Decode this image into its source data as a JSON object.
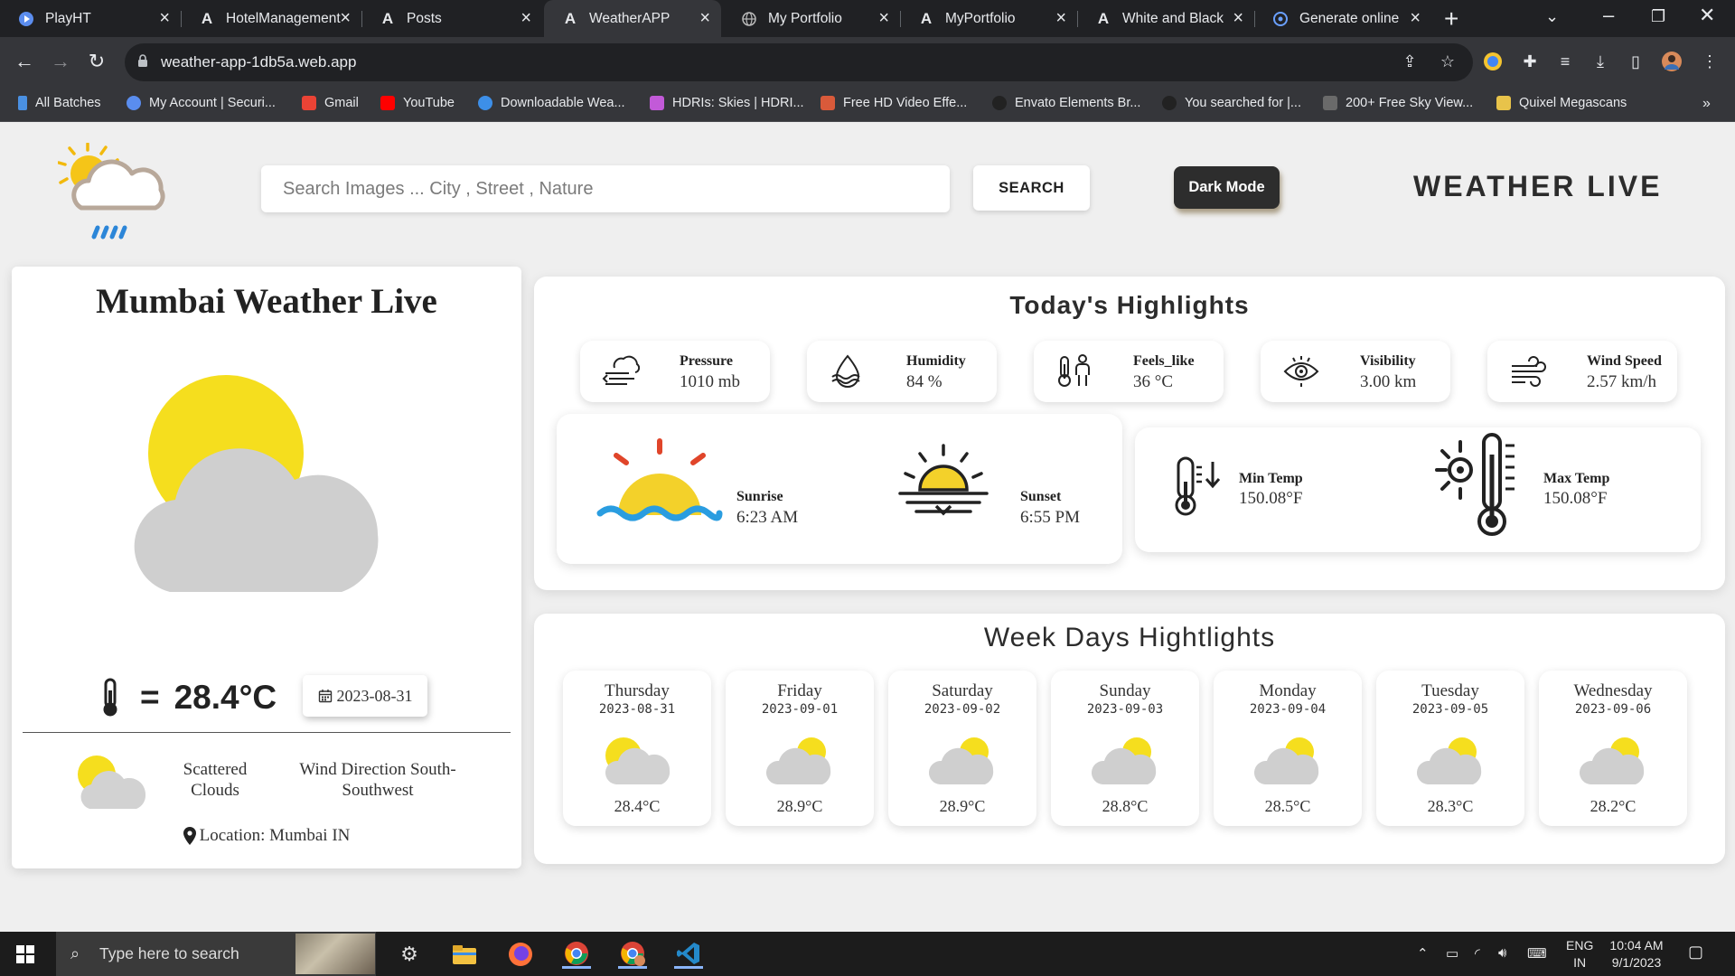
{
  "browser": {
    "tabs": [
      {
        "title": "PlayHT",
        "icon": "playht-icon"
      },
      {
        "title": "HotelManagement",
        "icon": "vercel-icon"
      },
      {
        "title": "Posts",
        "icon": "vercel-icon"
      },
      {
        "title": "WeatherAPP",
        "icon": "vercel-icon",
        "active": true
      },
      {
        "title": "My Portfolio",
        "icon": "globe-icon"
      },
      {
        "title": "MyPortfolio",
        "icon": "vercel-icon"
      },
      {
        "title": "White and Black",
        "icon": "vercel-icon"
      },
      {
        "title": "Generate online",
        "icon": "generator-icon"
      }
    ],
    "url": "weather-app-1db5a.web.app",
    "bookmarks": [
      {
        "label": "All Batches",
        "color": "#4a90e2"
      },
      {
        "label": "My Account | Securi...",
        "color": "#5a8dee"
      },
      {
        "label": "Gmail",
        "color": "#ea4335"
      },
      {
        "label": "YouTube",
        "color": "#ff0000"
      },
      {
        "label": "Downloadable Wea...",
        "color": "#3d8fe8"
      },
      {
        "label": "HDRIs: Skies | HDRI...",
        "color": "#c25ad8"
      },
      {
        "label": "Free HD Video Effe...",
        "color": "#d95a3a"
      },
      {
        "label": "Envato Elements Br...",
        "color": "#333333"
      },
      {
        "label": "You searched for |...",
        "color": "#333333"
      },
      {
        "label": "200+ Free Sky View...",
        "color": "#6a6a6a"
      },
      {
        "label": "Quixel Megascans",
        "color": "#e8c34a"
      }
    ]
  },
  "header": {
    "search_placeholder": "Search Images ... City , Street , Nature",
    "search_label": "SEARCH",
    "dark_mode_label": "Dark Mode",
    "app_title": "WEATHER LIVE"
  },
  "current": {
    "city_title": "Mumbai Weather Live",
    "temp_prefix": "=",
    "temp": "28.4°C",
    "date": "2023-08-31",
    "condition": "Scattered Clouds",
    "wind_direction": "Wind Direction South-Southwest",
    "location": "Location: Mumbai IN"
  },
  "highlights": {
    "title": "Today's Highlights",
    "stats": [
      {
        "label": "Pressure",
        "value": "1010 mb",
        "icon": "pressure-icon"
      },
      {
        "label": "Humidity",
        "value": "84 %",
        "icon": "humidity-icon"
      },
      {
        "label": "Feels_like",
        "value": "36 °C",
        "icon": "feels-like-icon"
      },
      {
        "label": "Visibility",
        "value": "3.00 km",
        "icon": "visibility-icon"
      },
      {
        "label": "Wind Speed",
        "value": "2.57 km/h",
        "icon": "wind-icon"
      }
    ],
    "sunrise_label": "Sunrise",
    "sunrise_value": "6:23 AM",
    "sunset_label": "Sunset",
    "sunset_value": "6:55 PM",
    "min_label": "Min Temp",
    "min_value": "150.08°F",
    "max_label": "Max Temp",
    "max_value": "150.08°F"
  },
  "week": {
    "title": "Week Days Hightlights",
    "days": [
      {
        "day": "Thursday",
        "date": "2023-08-31",
        "temp": "28.4°C"
      },
      {
        "day": "Friday",
        "date": "2023-09-01",
        "temp": "28.9°C"
      },
      {
        "day": "Saturday",
        "date": "2023-09-02",
        "temp": "28.9°C"
      },
      {
        "day": "Sunday",
        "date": "2023-09-03",
        "temp": "28.8°C"
      },
      {
        "day": "Monday",
        "date": "2023-09-04",
        "temp": "28.5°C"
      },
      {
        "day": "Tuesday",
        "date": "2023-09-05",
        "temp": "28.3°C"
      },
      {
        "day": "Wednesday",
        "date": "2023-09-06",
        "temp": "28.2°C"
      }
    ]
  },
  "taskbar": {
    "search_text": "Type here to search",
    "lang_top": "ENG",
    "lang_bottom": "IN",
    "time": "10:04 AM",
    "date": "9/1/2023"
  },
  "colors": {
    "sun": "#f5de1e",
    "cloud": "#cfcfcf",
    "accent_dark": "#2d2d2d"
  }
}
